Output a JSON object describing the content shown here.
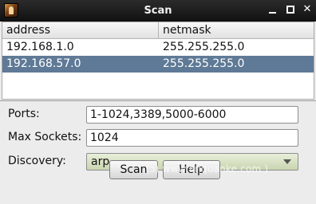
{
  "window": {
    "title": "Scan"
  },
  "table": {
    "columns": [
      "address",
      "netmask"
    ],
    "rows": [
      {
        "address": "192.168.1.0",
        "netmask": "255.255.255.0"
      },
      {
        "address": "192.168.57.0",
        "netmask": "255.255.255.0"
      }
    ]
  },
  "form": {
    "ports_label": "Ports:",
    "ports_value": "1-1024,3389,5000-6000",
    "max_sockets_label": "Max Sockets:",
    "max_sockets_value": "1024",
    "discovery_label": "Discovery:",
    "discovery_value": "arp"
  },
  "buttons": {
    "scan": "Scan",
    "help": "Help"
  },
  "watermark": "(ɔ) www.anquanke.com )"
}
